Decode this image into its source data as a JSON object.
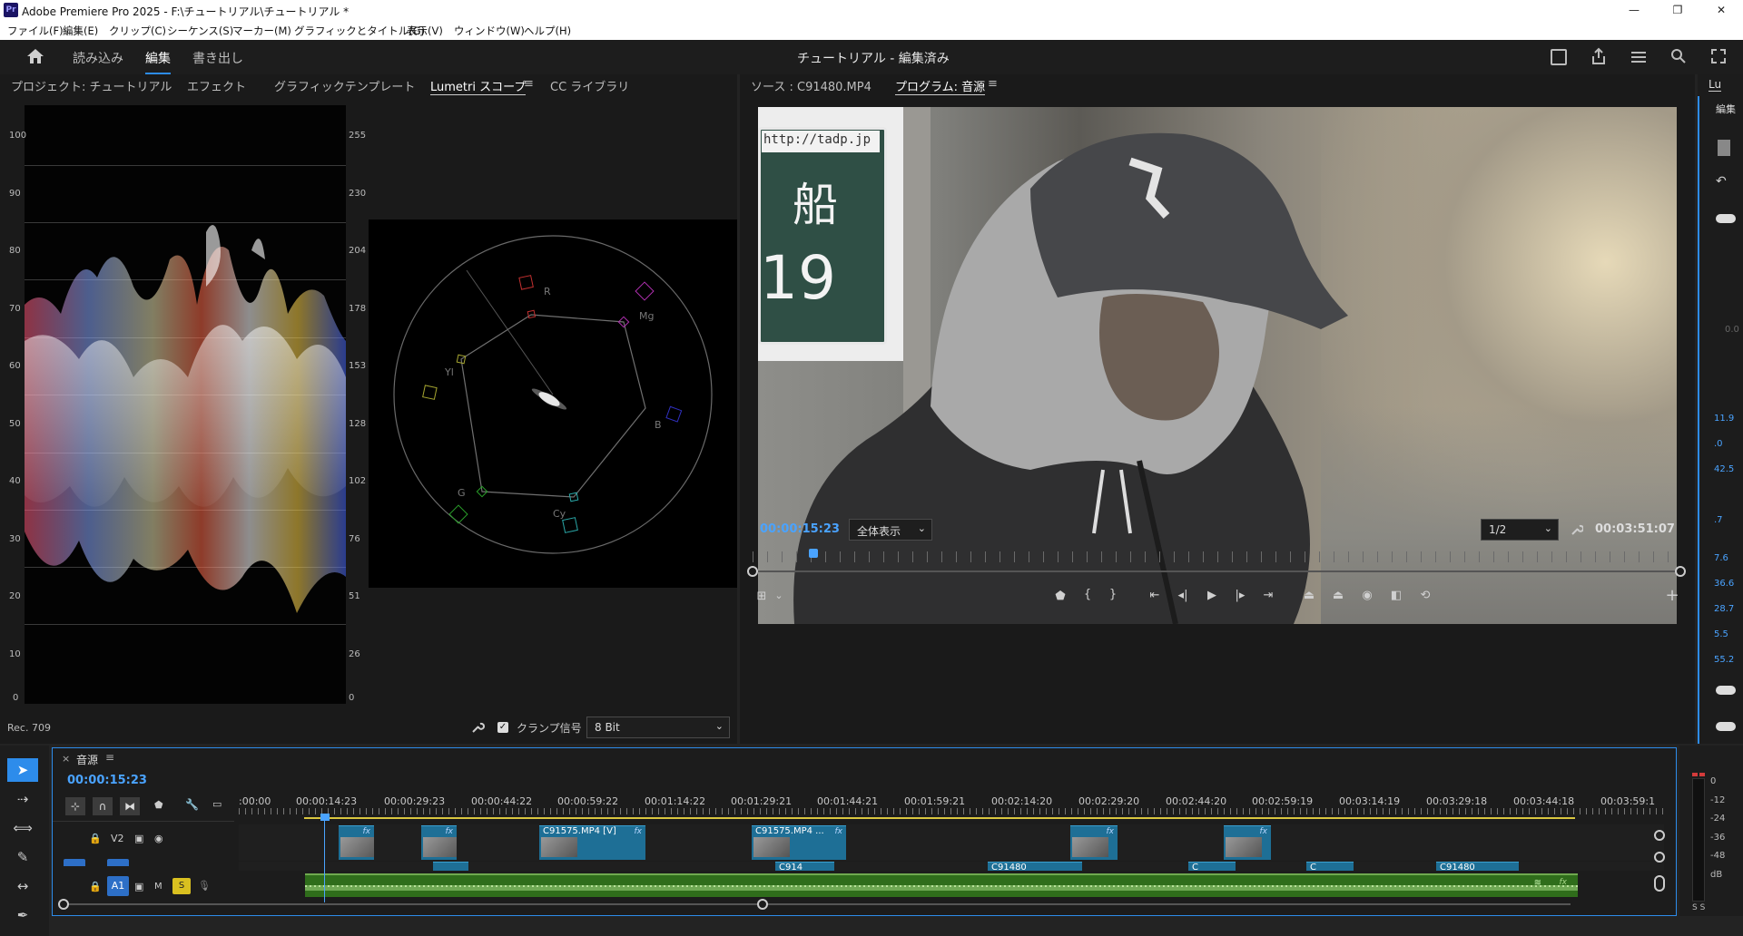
{
  "window": {
    "title": "Adobe Premiere Pro 2025 - F:\\チュートリアル\\チュートリアル *",
    "app_icon": "Pr",
    "controls": [
      "—",
      "❐",
      "✕"
    ]
  },
  "menu": [
    "ファイル(F)",
    "編集(E)",
    "クリップ(C)",
    "シーケンス(S)",
    "マーカー(M)",
    "グラフィックとタイトル(G)",
    "表示(V)",
    "ウィンドウ(W)",
    "ヘルプ(H)"
  ],
  "workspace": {
    "tabs": [
      "読み込み",
      "編集",
      "書き出し"
    ],
    "active": "編集",
    "project_title": "チュートリアル - 編集済み"
  },
  "left_panel": {
    "tabs": [
      "プロジェクト: チュートリアル",
      "エフェクト",
      "グラフィックテンプレート",
      "Lumetri スコープ",
      "CC ライブラリ"
    ],
    "active_tab": "Lumetri スコープ",
    "waveform_left_scale": [
      "100",
      "90",
      "80",
      "70",
      "60",
      "50",
      "40",
      "30",
      "20",
      "10",
      "0"
    ],
    "waveform_right_scale": [
      "255",
      "230",
      "204",
      "178",
      "153",
      "128",
      "102",
      "76",
      "51",
      "26",
      "0"
    ],
    "vectorscope_labels": {
      "r": "R",
      "mg": "Mg",
      "b": "B",
      "cy": "Cy",
      "g": "G",
      "yl": "Yl"
    },
    "color_space": "Rec. 709",
    "clamp_label": "クランプ信号",
    "clamp_checked": true,
    "bit_depth": "8 Bit"
  },
  "monitor": {
    "tabs": [
      "ソース : C91480.MP4",
      "プログラム: 音源"
    ],
    "active_tab": "プログラム: 音源",
    "sign_url": "http://tadp.jp",
    "sign_char": "船",
    "sign_number": "19",
    "timecode": "00:00:15:23",
    "zoom": "全体表示",
    "resolution": "1/2",
    "duration": "00:03:51:07",
    "playhead_fraction": 0.045
  },
  "right_strip": {
    "header": "Lu",
    "sub": "編集",
    "values": [
      "0.0",
      "11.9",
      ".0",
      "42.5",
      ".7",
      "7.6",
      "36.6",
      "28.7",
      "5.5",
      "55.2"
    ]
  },
  "timeline": {
    "sequence_name": "音源",
    "timecode": "00:00:15:23",
    "ruler": [
      ":00:00",
      "00:00:14:23",
      "00:00:29:23",
      "00:00:44:22",
      "00:00:59:22",
      "00:01:14:22",
      "00:01:29:21",
      "00:01:44:21",
      "00:01:59:21",
      "00:02:14:20",
      "00:02:29:20",
      "00:02:44:20",
      "00:02:59:19",
      "00:03:14:19",
      "00:03:29:18",
      "00:03:44:18",
      "00:03:59:1"
    ],
    "tracks": {
      "v2": "V2",
      "a1": "A1",
      "m": "M",
      "s": "S"
    },
    "v2_clips": [
      {
        "label": "",
        "start": 0.0,
        "end": 0.03
      },
      {
        "label": "",
        "start": 0.07,
        "end": 0.1
      },
      {
        "label": "C91575.MP4 [V]",
        "start": 0.17,
        "end": 0.26
      },
      {
        "label": "C91575.MP4 ...",
        "start": 0.35,
        "end": 0.43
      },
      {
        "label": "",
        "start": 0.62,
        "end": 0.66
      },
      {
        "label": "",
        "start": 0.75,
        "end": 0.79
      }
    ],
    "v1_clips": [
      {
        "label": "",
        "start": 0.08,
        "end": 0.11
      },
      {
        "label": "C914",
        "start": 0.37,
        "end": 0.42
      },
      {
        "label": "C91480",
        "start": 0.55,
        "end": 0.63
      },
      {
        "label": "C",
        "start": 0.72,
        "end": 0.76
      },
      {
        "label": "C",
        "start": 0.82,
        "end": 0.86
      },
      {
        "label": "C91480",
        "start": 0.93,
        "end": 1.0
      }
    ]
  },
  "meter": {
    "scale": [
      "0",
      "-12",
      "-24",
      "-36",
      "-48",
      "dB"
    ],
    "solo": "S S"
  },
  "colors": {
    "accent": "#2d8ceb",
    "timecode_blue": "#4aa3ff",
    "clip_blue": "#1e6f96",
    "audio_green": "#2f6d1b"
  }
}
